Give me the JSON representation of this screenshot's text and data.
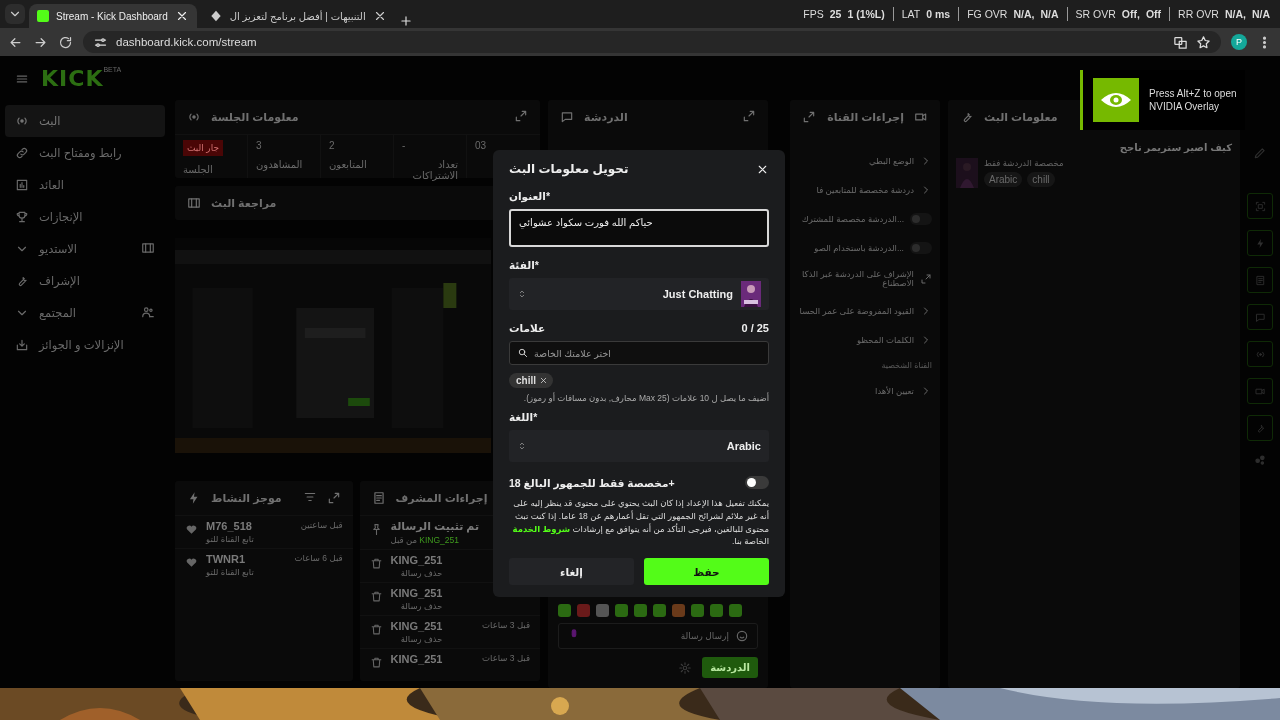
{
  "browser": {
    "tabs": [
      {
        "title": "التنبيهات | أفضل برنامج لتعزيز ال",
        "selected": false
      },
      {
        "title": "Stream - Kick Dashboard",
        "selected": true
      }
    ],
    "url": "dashboard.kick.com/stream",
    "profile_initial": "P"
  },
  "perf_overlay": [
    {
      "label": "RR OVR",
      "values": [
        "N/A",
        "N/A,"
      ]
    },
    {
      "label": "SR OVR",
      "values": [
        "Off",
        "Off,"
      ]
    },
    {
      "label": "FG OVR",
      "values": [
        "N/A",
        "N/A,"
      ]
    },
    {
      "label": "LAT",
      "values": [
        "0 ms"
      ]
    },
    {
      "label": "FPS",
      "values": [
        "1 (1%L)",
        "25"
      ]
    }
  ],
  "nvidia_toast": {
    "text": "Press Alt+Z to open NVIDIA Overlay"
  },
  "sidebar": {
    "logo": "KICK",
    "logo_badge": "BETA",
    "items": [
      {
        "label": "البث",
        "kind": "link",
        "selected": true
      },
      {
        "label": "رابط ومفتاح البث",
        "kind": "link",
        "selected": false
      },
      {
        "label": "العائد",
        "kind": "link",
        "selected": false
      },
      {
        "label": "الإنجازات",
        "kind": "link",
        "selected": false
      },
      {
        "label": "الاستديو",
        "kind": "group",
        "selected": false
      },
      {
        "label": "الإشراف",
        "kind": "link",
        "selected": false
      },
      {
        "label": "المجتمع",
        "kind": "group",
        "selected": false
      },
      {
        "label": "الإنزالات و الجوائز",
        "kind": "link",
        "selected": false
      }
    ]
  },
  "session_panel": {
    "title": "معلومات الجلسة",
    "stats": [
      {
        "kind": "number",
        "value": "03"
      },
      {
        "kind": "number",
        "value": "-",
        "label": "تعداد الاشتراكات"
      },
      {
        "kind": "number",
        "value": "2",
        "label": "المتابعون"
      },
      {
        "kind": "number",
        "value": "3",
        "label": "المشاهدون"
      },
      {
        "kind": "live",
        "value": "جار البث",
        "label": "الجلسة"
      }
    ]
  },
  "review_panel": {
    "title": "مراجعة البث"
  },
  "activity_feed": {
    "title": "موجز النشاط",
    "rows": [
      {
        "user": "M76_518",
        "event": "تابع القناة للتو",
        "time": "قبل ساعتين"
      },
      {
        "user": "TWNR1",
        "event": "تابع القناة للتو",
        "time": "قبل 6 ساعات"
      }
    ]
  },
  "mod_actions": {
    "title": "إجراءات المشرف",
    "rows": [
      {
        "kind": "pin",
        "title": "تم تثبيت الرسالة",
        "by_prefix": "من قبل",
        "by_user": "KING_251"
      },
      {
        "kind": "delete",
        "title": "KING_251",
        "detail": "حذف رسالة"
      },
      {
        "kind": "delete",
        "title": "KING_251",
        "detail": "حذف رسالة"
      },
      {
        "kind": "delete",
        "title": "KING_251",
        "detail": "حذف رسالة",
        "time": "قبل 3 ساعات"
      },
      {
        "kind": "delete",
        "title": "KING_251",
        "time": "قبل 3 ساعات"
      }
    ]
  },
  "chat": {
    "title": "الدردشة",
    "input_placeholder": "إرسال رسالة",
    "send_label": "الدردشة"
  },
  "channel_actions": {
    "title": "إجراءات القناة",
    "items": [
      {
        "kind": "link",
        "label": "الوضع البطي"
      },
      {
        "kind": "link",
        "label": "دردشة مخصصة للمتابعين فا"
      },
      {
        "kind": "toggle",
        "label": "...الدردشة مخصصة للمشترك",
        "on": false
      },
      {
        "kind": "toggle",
        "label": "...الدردشة باستخدام الصو",
        "on": false
      },
      {
        "kind": "external",
        "label": "الإشراف على الدردشة عبر الذكا الاصطناع"
      },
      {
        "kind": "link",
        "label": "القيود المفروضة على عمر الحسا"
      },
      {
        "kind": "link",
        "label": "الكلمات المحظو"
      },
      {
        "kind": "section",
        "label": "القناة الشخصية"
      },
      {
        "kind": "link",
        "label": "تعيين الأهدا"
      }
    ]
  },
  "stream_info": {
    "title": "معلومات البث",
    "stream_title": "كيف اصير ستريمر ناجح",
    "category_line": "مخصصة الدردشة فقط",
    "tags": [
      "chill",
      "Arabic"
    ]
  },
  "modal": {
    "title": "تحويل معلومات البث",
    "title_field": {
      "label": "العنوان*",
      "value": "حياكم الله فورت سكواد عشوائي"
    },
    "category_field": {
      "label": "الفئة*",
      "value": "Just Chatting"
    },
    "tags_field": {
      "label": "علامات",
      "counter": "0 / 25",
      "placeholder": "اختر علامتك الخاصة",
      "tags": [
        "chill"
      ],
      "hint": "أضيف ما يصل ل 10 علامات (Max 25 محارف, بدون مسافات أو رموز)."
    },
    "language_field": {
      "label": "اللغة*",
      "value": "Arabic"
    },
    "adult_only": {
      "label": "مخصصة فقط للجمهور البالغ 18+",
      "on": false,
      "description_before": "يمكنك تفعيل هذا الإعداد إذا كان البث يحتوي على محتوى قد ينظر إليه على أنه غير ملائم لشرائح الجمهور التي تقل أعمارهم عن 18 عاما. إذا كنت تبث محتوى للبالغين، فيرجى التأكد من أنه يتوافق مع إرشادات",
      "link": "شروط الخدمة",
      "description_after": "الخاصة بنا."
    },
    "cancel_label": "إلغاء",
    "save_label": "حفظ"
  }
}
